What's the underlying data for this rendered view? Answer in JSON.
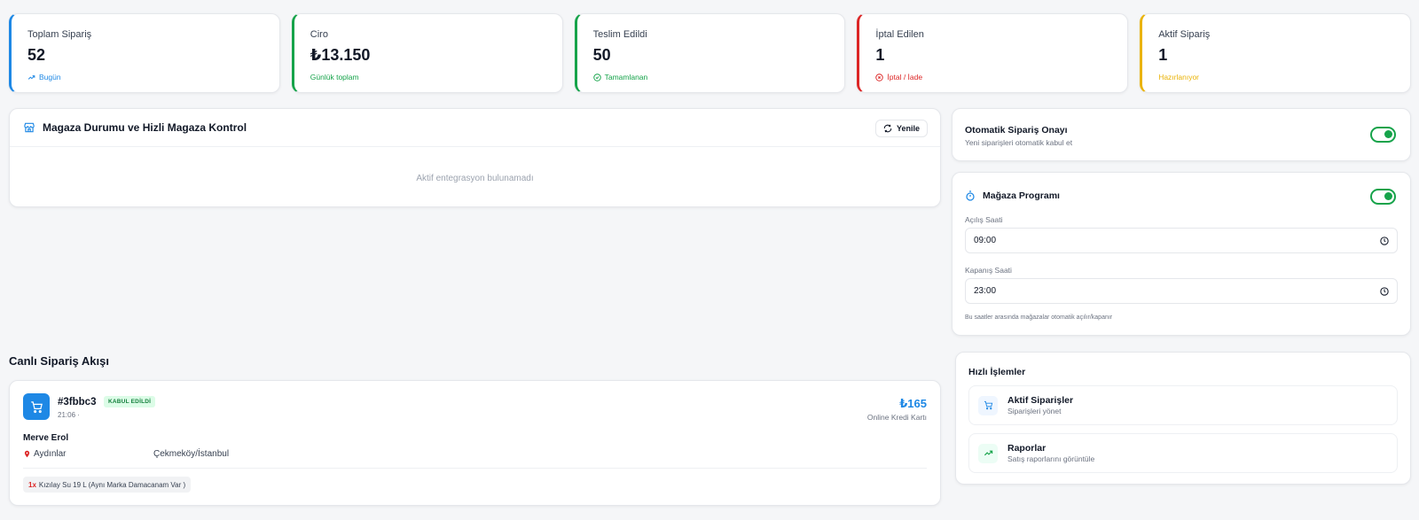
{
  "stats": [
    {
      "label": "Toplam Sipariş",
      "value": "52",
      "sub": "Bugün",
      "color": "#1e88e5",
      "icon": "trending-up-icon"
    },
    {
      "label": "Ciro",
      "value": "₺13.150",
      "sub": "Günlük toplam",
      "color": "#16a34a",
      "icon": ""
    },
    {
      "label": "Teslim Edildi",
      "value": "50",
      "sub": "Tamamlanan",
      "color": "#16a34a",
      "icon": "check-circle-icon"
    },
    {
      "label": "İptal Edilen",
      "value": "1",
      "sub": "İptal / İade",
      "color": "#dc2626",
      "icon": "x-circle-icon"
    },
    {
      "label": "Aktif Sipariş",
      "value": "1",
      "sub": "Hazırlanıyor",
      "color": "#eab308",
      "icon": ""
    }
  ],
  "store": {
    "title": "Magaza Durumu ve Hizli Magaza Kontrol",
    "refresh_label": "Yenile",
    "empty_message": "Aktif entegrasyon bulunamadı"
  },
  "auto_approve": {
    "title": "Otomatik Sipariş Onayı",
    "subtitle": "Yeni siparişleri otomatik kabul et",
    "enabled": true
  },
  "schedule": {
    "title": "Mağaza Programı",
    "enabled": true,
    "open_label": "Açılış Saati",
    "open_value": "09:00",
    "close_label": "Kapanış Saati",
    "close_value": "23:00",
    "note": "Bu saatler arasında mağazalar otomatik açılır/kapanır"
  },
  "quick_actions": {
    "title": "Hızlı İşlemler",
    "items": [
      {
        "title": "Aktif Siparişler",
        "subtitle": "Siparişleri yönet",
        "icon": "cart-icon"
      },
      {
        "title": "Raporlar",
        "subtitle": "Satış raporlarını görüntüle",
        "icon": "trending-up-icon"
      }
    ]
  },
  "live_orders": {
    "title": "Canlı Sipariş Akışı",
    "orders": [
      {
        "id": "#3fbbc3",
        "status": "KABUL EDİLDİ",
        "time": "21:06 ·",
        "price": "₺165",
        "payment": "Online Kredi Kartı",
        "customer": "Merve Erol",
        "district": "Aydınlar",
        "city": "Çekmeköy/İstanbul",
        "item_qty": "1x",
        "item_name": "Kızılay Su 19 L (Aynı Marka Damacanam Var )"
      }
    ]
  },
  "colors": {
    "accent_blue": "#1e88e5",
    "success_green": "#16a34a",
    "danger_red": "#dc2626",
    "warning_yellow": "#eab308"
  }
}
